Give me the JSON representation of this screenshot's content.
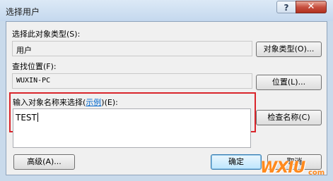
{
  "window": {
    "title": "选择用户",
    "help_glyph": "?",
    "close_glyph": "✕"
  },
  "object_type": {
    "label": "选择此对象类型(S):",
    "value": "用户",
    "button_label": "对象类型(O)..."
  },
  "location": {
    "label": "查找位置(F):",
    "value": "WUXIN-PC",
    "button_label": "位置(L)..."
  },
  "object_names": {
    "label_prefix": "输入对象名称来选择(",
    "example_link": "示例",
    "label_suffix": ")(E):",
    "value": "TEST",
    "check_button_label": "检查名称(C)"
  },
  "buttons": {
    "advanced": "高级(A)...",
    "ok": "确定",
    "cancel": "取消"
  },
  "watermark": {
    "text": "WXIU",
    "suffix": "com"
  },
  "colors": {
    "highlight_box": "#d9252b",
    "link": "#0066cc",
    "close_button": "#c75040"
  }
}
